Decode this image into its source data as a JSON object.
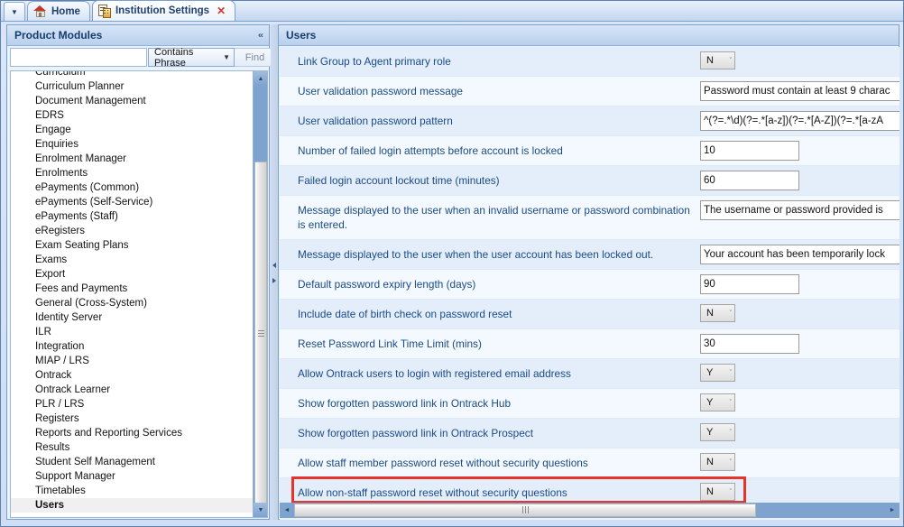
{
  "window": {
    "tab_dropdown_icon": "chevron-down-icon",
    "tabs": [
      {
        "label": "Home",
        "icon": "home-icon",
        "active": false,
        "closable": false
      },
      {
        "label": "Institution Settings",
        "icon": "institution-icon",
        "active": true,
        "closable": true,
        "close_label": "✕"
      }
    ]
  },
  "left_panel": {
    "title": "Product Modules",
    "collapse_icon": "chevron-up-double-icon",
    "collapse_glyph": "«",
    "search": {
      "value": "",
      "placeholder": "",
      "mode_label": "Contains Phrase",
      "mode_caret": "▼",
      "find_label": "Find"
    },
    "items": [
      {
        "label": "Curriculum",
        "selected": false
      },
      {
        "label": "Curriculum Planner",
        "selected": false
      },
      {
        "label": "Document Management",
        "selected": false
      },
      {
        "label": "EDRS",
        "selected": false
      },
      {
        "label": "Engage",
        "selected": false
      },
      {
        "label": "Enquiries",
        "selected": false
      },
      {
        "label": "Enrolment Manager",
        "selected": false
      },
      {
        "label": "Enrolments",
        "selected": false
      },
      {
        "label": "ePayments (Common)",
        "selected": false
      },
      {
        "label": "ePayments (Self-Service)",
        "selected": false
      },
      {
        "label": "ePayments (Staff)",
        "selected": false
      },
      {
        "label": "eRegisters",
        "selected": false
      },
      {
        "label": "Exam Seating Plans",
        "selected": false
      },
      {
        "label": "Exams",
        "selected": false
      },
      {
        "label": "Export",
        "selected": false
      },
      {
        "label": "Fees and Payments",
        "selected": false
      },
      {
        "label": "General (Cross-System)",
        "selected": false
      },
      {
        "label": "Identity Server",
        "selected": false
      },
      {
        "label": "ILR",
        "selected": false
      },
      {
        "label": "Integration",
        "selected": false
      },
      {
        "label": "MIAP / LRS",
        "selected": false
      },
      {
        "label": "Ontrack",
        "selected": false
      },
      {
        "label": "Ontrack Learner",
        "selected": false
      },
      {
        "label": "PLR / LRS",
        "selected": false
      },
      {
        "label": "Registers",
        "selected": false
      },
      {
        "label": "Reports and Reporting Services",
        "selected": false
      },
      {
        "label": "Results",
        "selected": false
      },
      {
        "label": "Student Self Management",
        "selected": false
      },
      {
        "label": "Support Manager",
        "selected": false
      },
      {
        "label": "Timetables",
        "selected": false
      },
      {
        "label": "Users",
        "selected": true
      }
    ],
    "scrollbar": {
      "up_arrow": "▲",
      "down_arrow": "▼"
    }
  },
  "right_panel": {
    "title": "Users",
    "rows": [
      {
        "label": "Link Group to Agent primary role",
        "control": "combo",
        "value": "N"
      },
      {
        "label": "User validation password message",
        "control": "text-wide",
        "value": "Password must contain at least 9 charac"
      },
      {
        "label": "User validation password pattern",
        "control": "text-wide",
        "value": "^(?=.*\\d)(?=.*[a-z])(?=.*[A-Z])(?=.*[a-zA"
      },
      {
        "label": "Number of failed login attempts before account is locked",
        "control": "text-num",
        "value": "10"
      },
      {
        "label": "Failed login account lockout time (minutes)",
        "control": "text-num",
        "value": "60"
      },
      {
        "label": "Message displayed to the user when an invalid username or password combination is entered.",
        "control": "text-wide",
        "value": "The username or password provided is"
      },
      {
        "label": "Message displayed to the user when the user account has been locked out.",
        "control": "text-wide",
        "value": "Your account has been temporarily lock"
      },
      {
        "label": "Default password expiry length (days)",
        "control": "text-num",
        "value": "90"
      },
      {
        "label": "Include date of birth check on password reset",
        "control": "combo",
        "value": "N"
      },
      {
        "label": "Reset Password Link Time Limit (mins)",
        "control": "text-num",
        "value": "30"
      },
      {
        "label": "Allow Ontrack users to login with registered email address",
        "control": "combo",
        "value": "Y"
      },
      {
        "label": "Show forgotten password link in Ontrack Hub",
        "control": "combo",
        "value": "Y"
      },
      {
        "label": "Show forgotten password link in Ontrack Prospect",
        "control": "combo",
        "value": "Y"
      },
      {
        "label": "Allow staff member password reset without security questions",
        "control": "combo",
        "value": "N"
      },
      {
        "label": "Allow non-staff password reset without security questions",
        "control": "combo",
        "value": "N",
        "highlighted": true
      }
    ],
    "combo_caret": "ˇ",
    "scrollbar": {
      "left_arrow": "◄",
      "right_arrow": "►"
    }
  },
  "colors": {
    "accent": "#1a4b86",
    "highlight": "#e8332a",
    "row_alt": "#e4eefb",
    "panel_header": "#c9dcf3",
    "chrome": "#7ba0ce"
  }
}
